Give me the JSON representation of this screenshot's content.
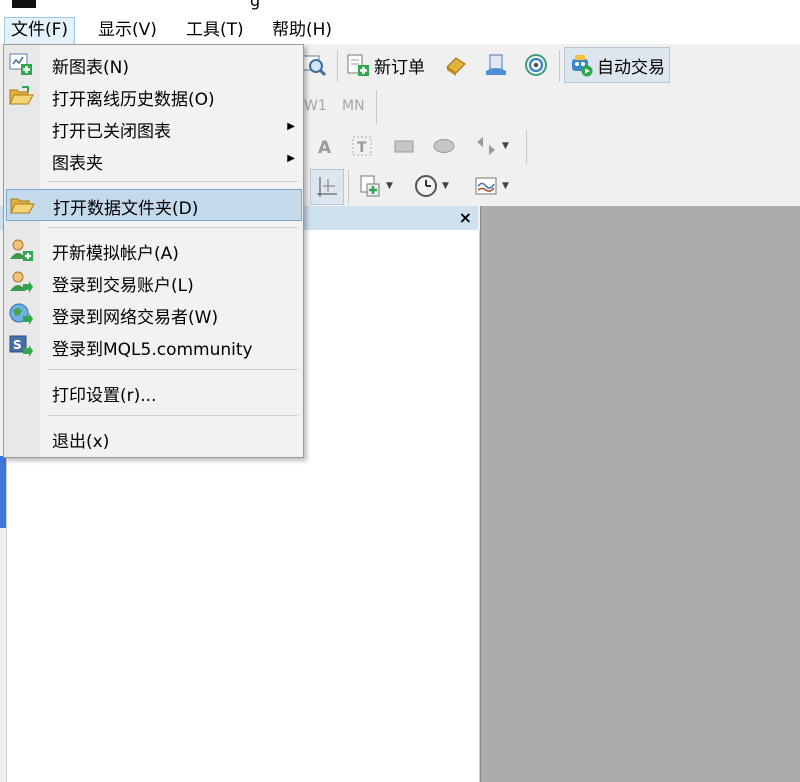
{
  "titlebar": {
    "title_fragment": "g"
  },
  "menubar": {
    "file": "文件(F)",
    "view": "显示(V)",
    "tools": "工具(T)",
    "help": "帮助(H)"
  },
  "toolbar": {
    "new_order": "新订单",
    "auto_trading": "自动交易",
    "timeframe_w1": "W1",
    "timeframe_mn": "MN"
  },
  "file_menu": {
    "items": [
      {
        "label": "新图表(N)",
        "icon": "new-chart-icon"
      },
      {
        "label": "打开离线历史数据(O)",
        "icon": "open-folder-icon"
      },
      {
        "label": "打开已关闭图表",
        "icon": "",
        "submenu": true
      },
      {
        "label": "图表夹",
        "icon": "",
        "submenu": true
      },
      {
        "label": "打开数据文件夹(D)",
        "icon": "folder-icon",
        "selected": true
      },
      {
        "label": "开新模拟帐户(A)",
        "icon": "add-user-icon"
      },
      {
        "label": "登录到交易账户(L)",
        "icon": "login-user-icon"
      },
      {
        "label": "登录到网络交易者(W)",
        "icon": "globe-login-icon"
      },
      {
        "label": "登录到MQL5.community",
        "icon": "mql5-login-icon"
      },
      {
        "label": "打印设置(r)...",
        "icon": ""
      },
      {
        "label": "退出(x)",
        "icon": ""
      }
    ]
  },
  "navigator": {
    "close": "×"
  },
  "colors": {
    "menu_selection": "#c4d9ea",
    "workspace": "#ababab",
    "panel_header": "#cfe0ef"
  }
}
